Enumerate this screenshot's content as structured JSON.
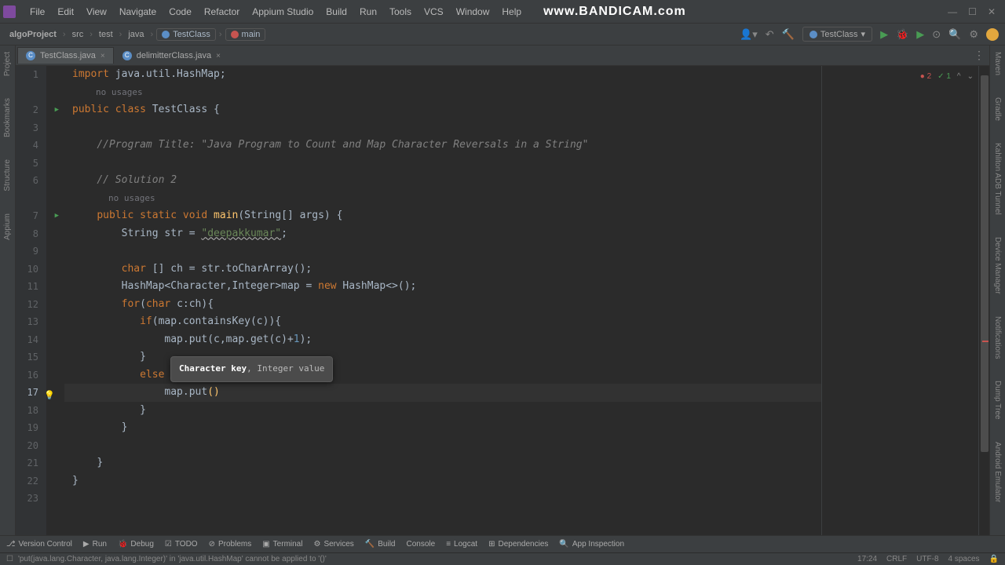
{
  "menu": [
    "File",
    "Edit",
    "View",
    "Navigate",
    "Code",
    "Refactor",
    "Appium Studio",
    "Build",
    "Run",
    "Tools",
    "VCS",
    "Window",
    "Help"
  ],
  "watermark": "www.BANDICAM.com",
  "breadcrumb": {
    "project": "algoProject",
    "parts": [
      "src",
      "test",
      "java"
    ],
    "class_pill": "TestClass",
    "method_pill": "main"
  },
  "run_config": "TestClass",
  "tabs": [
    {
      "label": "TestClass.java",
      "active": true
    },
    {
      "label": "delimitterClass.java",
      "active": false
    }
  ],
  "gutter_lines": [
    "1",
    "2",
    "3",
    "4",
    "5",
    "6",
    "7",
    "8",
    "9",
    "10",
    "11",
    "12",
    "13",
    "14",
    "15",
    "16",
    "17",
    "18",
    "19",
    "20",
    "21",
    "22",
    "23"
  ],
  "hints": {
    "line1_usage": "no usages",
    "line6_usage": "no usages"
  },
  "code": {
    "l1_import": "import",
    "l1_pkg": " java.util.HashMap;",
    "l2_pub": "public",
    "l2_class": " class ",
    "l2_name": "TestClass",
    "l2_brace": " {",
    "l4_comment": "//Program Title: \"Java Program to Count and Map Character Reversals in a String\"",
    "l6_comment": "// Solution 2",
    "l7_pub": "public",
    "l7_static": " static ",
    "l7_void": "void",
    "l7_main": " main",
    "l7_args": "(String[] args) {",
    "l8_str": "String str = ",
    "l8_val": "\"deepakkumar\"",
    "l8_semi": ";",
    "l10_char": "char",
    "l10_decl": " [] ch = str.toCharArray();",
    "l11_hm": "HashMap<",
    "l11_char": "Character",
    "l11_comma": ",",
    "l11_int": "Integer",
    "l11_rest": ">map = ",
    "l11_new": "new",
    "l11_ctor": " HashMap<>();",
    "l12_for": "for",
    "l12_paren": "(",
    "l12_char": "char",
    "l12_rest": " c:ch){",
    "l13_if": "if",
    "l13_cond": "(map.containsKey(c)){",
    "l14_put": "map.put(c,map.get(c)+",
    "l14_one": "1",
    "l14_end": ");",
    "l15": "}",
    "l16_else": "else",
    "l16_brace": " {",
    "l17_put": "map.put",
    "l17_par": "()",
    "l18": "}",
    "l19": "}",
    "l21": "}",
    "l22": "}"
  },
  "tooltip": {
    "bold": "Character key",
    "rest": ", Integer value"
  },
  "indicators": {
    "errors": "2",
    "warnings": "1"
  },
  "bottom_tools": [
    "Version Control",
    "Run",
    "Debug",
    "TODO",
    "Problems",
    "Terminal",
    "Services",
    "Build",
    "Console",
    "Logcat",
    "Dependencies",
    "App Inspection"
  ],
  "status": {
    "message": "'put(java.lang.Character, java.lang.Integer)' in 'java.util.HashMap' cannot be applied to '()'",
    "pos": "17:24",
    "eol": "CRLF",
    "enc": "UTF-8",
    "indent": "4 spaces"
  },
  "left_strip": [
    "Project",
    "Bookmarks",
    "Structure",
    "Appium"
  ],
  "right_strip": [
    "Maven",
    "Gradle",
    "Kahliton ADB Tunnel",
    "Device Manager",
    "Notifications",
    "Dump Tree",
    "Android Emulator"
  ]
}
